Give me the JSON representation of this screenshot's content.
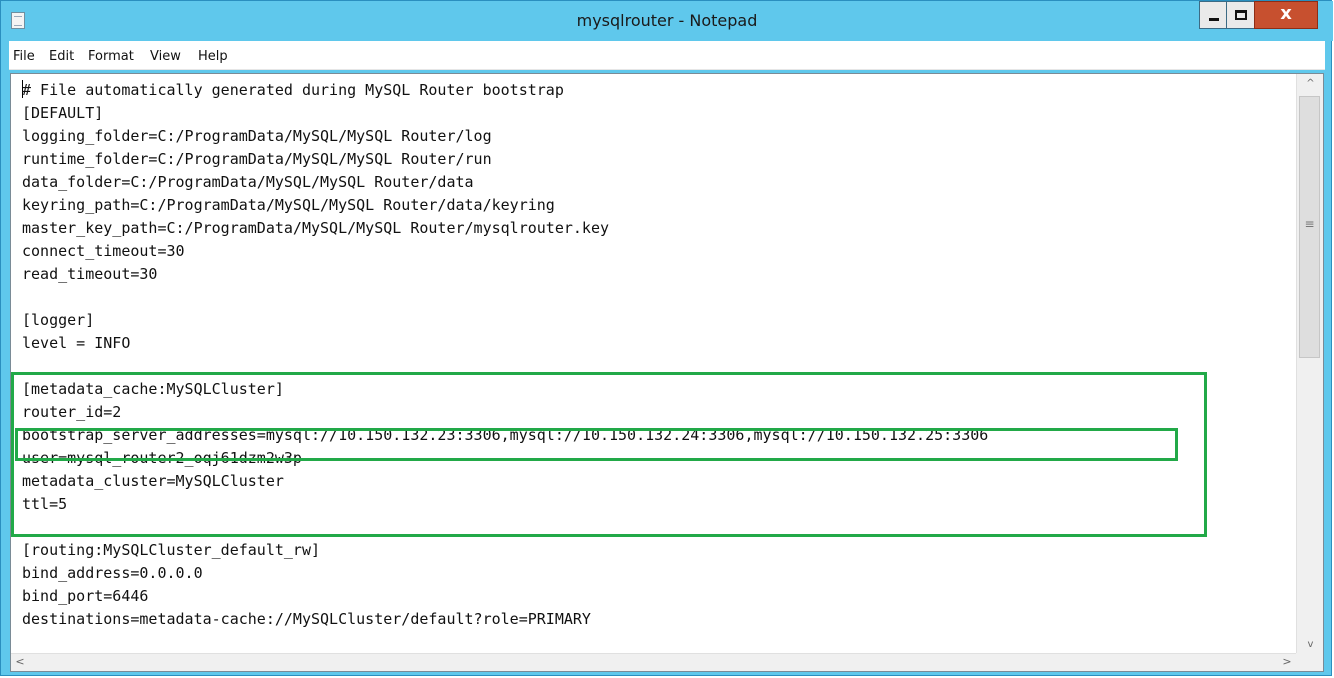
{
  "window": {
    "title": "mysqlrouter - Notepad",
    "close_glyph": "x"
  },
  "menu": {
    "items": [
      "File",
      "Edit",
      "Format",
      "View",
      "Help"
    ]
  },
  "editor": {
    "lines": [
      "# File automatically generated during MySQL Router bootstrap",
      "[DEFAULT]",
      "logging_folder=C:/ProgramData/MySQL/MySQL Router/log",
      "runtime_folder=C:/ProgramData/MySQL/MySQL Router/run",
      "data_folder=C:/ProgramData/MySQL/MySQL Router/data",
      "keyring_path=C:/ProgramData/MySQL/MySQL Router/data/keyring",
      "master_key_path=C:/ProgramData/MySQL/MySQL Router/mysqlrouter.key",
      "connect_timeout=30",
      "read_timeout=30",
      "",
      "[logger]",
      "level = INFO",
      "",
      "[metadata_cache:MySQLCluster]",
      "router_id=2",
      "bootstrap_server_addresses=mysql://10.150.132.23:3306,mysql://10.150.132.24:3306,mysql://10.150.132.25:3306",
      "user=mysql_router2_oqj61dzm2w3p",
      "metadata_cluster=MySQLCluster",
      "ttl=5",
      "",
      "[routing:MySQLCluster_default_rw]",
      "bind_address=0.0.0.0",
      "bind_port=6446",
      "destinations=metadata-cache://MySQLCluster/default?role=PRIMARY"
    ]
  },
  "scrollbars": {
    "up_arrow": "^",
    "down_arrow": "v",
    "left_arrow": "<",
    "right_arrow": ">",
    "grip": "≡"
  },
  "colors": {
    "titlebar": "#5fc8ec",
    "close_button": "#c7502f",
    "highlight": "#22a948"
  }
}
